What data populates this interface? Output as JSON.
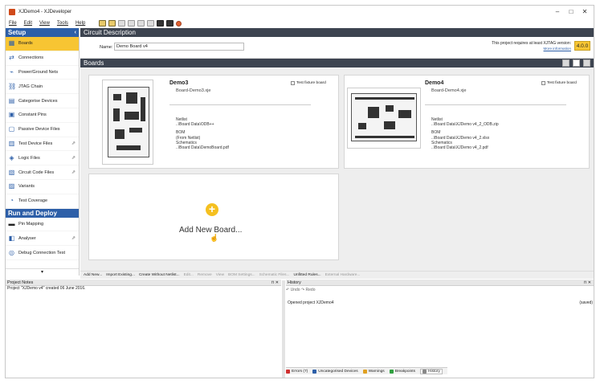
{
  "window": {
    "title": "XJDemo4 - XJDeveloper"
  },
  "menu": [
    "File",
    "Edit",
    "View",
    "Tools",
    "Help"
  ],
  "sidebar": {
    "setup_label": "Setup",
    "items": [
      {
        "label": "Boards",
        "icon": "board-icon",
        "active": true,
        "ext": false
      },
      {
        "label": "Connections",
        "icon": "connections-icon",
        "active": false,
        "ext": false
      },
      {
        "label": "Power/Ground Nets",
        "icon": "power-icon",
        "active": false,
        "ext": false
      },
      {
        "label": "JTAG Chain",
        "icon": "jtag-icon",
        "active": false,
        "ext": false
      },
      {
        "label": "Categorise Devices",
        "icon": "categorise-icon",
        "active": false,
        "ext": false
      },
      {
        "label": "Constant Pins",
        "icon": "pin-icon",
        "active": false,
        "ext": false
      },
      {
        "label": "Passive Device Files",
        "icon": "file-icon",
        "active": false,
        "ext": false
      },
      {
        "label": "Test Device Files",
        "icon": "test-file-icon",
        "active": false,
        "ext": true
      },
      {
        "label": "Logic Files",
        "icon": "logic-icon",
        "active": false,
        "ext": true
      },
      {
        "label": "Circuit Code Files",
        "icon": "code-icon",
        "active": false,
        "ext": true
      },
      {
        "label": "Variants",
        "icon": "variants-icon",
        "active": false,
        "ext": false
      },
      {
        "label": "Test Coverage",
        "icon": "coverage-icon",
        "active": false,
        "ext": false
      }
    ],
    "run_label": "Run and Deploy",
    "run_items": [
      {
        "label": "Pin Mapping",
        "icon": "pin-mapping-icon",
        "ext": false
      },
      {
        "label": "Analyser",
        "icon": "analyser-icon",
        "ext": true
      },
      {
        "label": "Debug Connection Test",
        "icon": "debug-icon",
        "ext": false
      }
    ]
  },
  "circuit": {
    "header": "Circuit Description",
    "name_label": "Name:",
    "name_value": "Demo Board v4",
    "requirement": "This project requires at least XJTAG version:",
    "more_info": "More information",
    "version": "4.0.0"
  },
  "boards": {
    "header": "Boards",
    "cards": [
      {
        "name": "Demo3",
        "file": "Board-Demo3.xje",
        "fixture": "Test fixture board",
        "netlist_label": "Netlist",
        "netlist": "..\\Board Data\\ODB++",
        "bom_label": "BOM",
        "bom": "(From Netlist)",
        "schematics_label": "Schematics",
        "schematics": "..\\Board Data\\DemoBoard.pdf"
      },
      {
        "name": "Demo4",
        "file": "Board-Demo4.xje",
        "fixture": "Test fixture board",
        "netlist_label": "Netlist",
        "netlist": "..\\Board Data\\XJDemo v4_2_ODB.zip",
        "bom_label": "BOM",
        "bom": "..\\Board Data\\XJDemo v4_2.xlsx",
        "schematics_label": "Schematics",
        "schematics": "..\\Board Data\\XJDemo v4_2.pdf"
      }
    ],
    "add_label": "Add New Board..."
  },
  "actions": [
    {
      "label": "Add New...",
      "disabled": false
    },
    {
      "label": "Import Existing...",
      "disabled": false
    },
    {
      "label": "Create Without Netlist...",
      "disabled": false
    },
    {
      "label": "Edit...",
      "disabled": true
    },
    {
      "label": "Remove",
      "disabled": true
    },
    {
      "label": "View",
      "disabled": true
    },
    {
      "label": "BOM Settings...",
      "disabled": true
    },
    {
      "label": "Schematic Files...",
      "disabled": true
    },
    {
      "label": "Unfitted Rules...",
      "disabled": false
    },
    {
      "label": "External Hardware...",
      "disabled": true
    }
  ],
  "notes": {
    "header": "Project Notes",
    "text": "Project \"XJDemo v4\" created 06 June 2016."
  },
  "history": {
    "header": "History",
    "undo": "Undo",
    "redo": "Redo",
    "entry": "Opened project XJDemo4",
    "entry_tag": "(saved)"
  },
  "bottom_tabs": [
    {
      "label": "Errors (7)",
      "color": "#d03030",
      "selected": false
    },
    {
      "label": "Uncategorised Devices",
      "color": "#2d5fa8",
      "selected": false
    },
    {
      "label": "Warnings",
      "color": "#e0a020",
      "selected": false
    },
    {
      "label": "Breakpoints",
      "color": "#30a040",
      "selected": false
    },
    {
      "label": "History",
      "color": "#888888",
      "selected": true
    }
  ]
}
